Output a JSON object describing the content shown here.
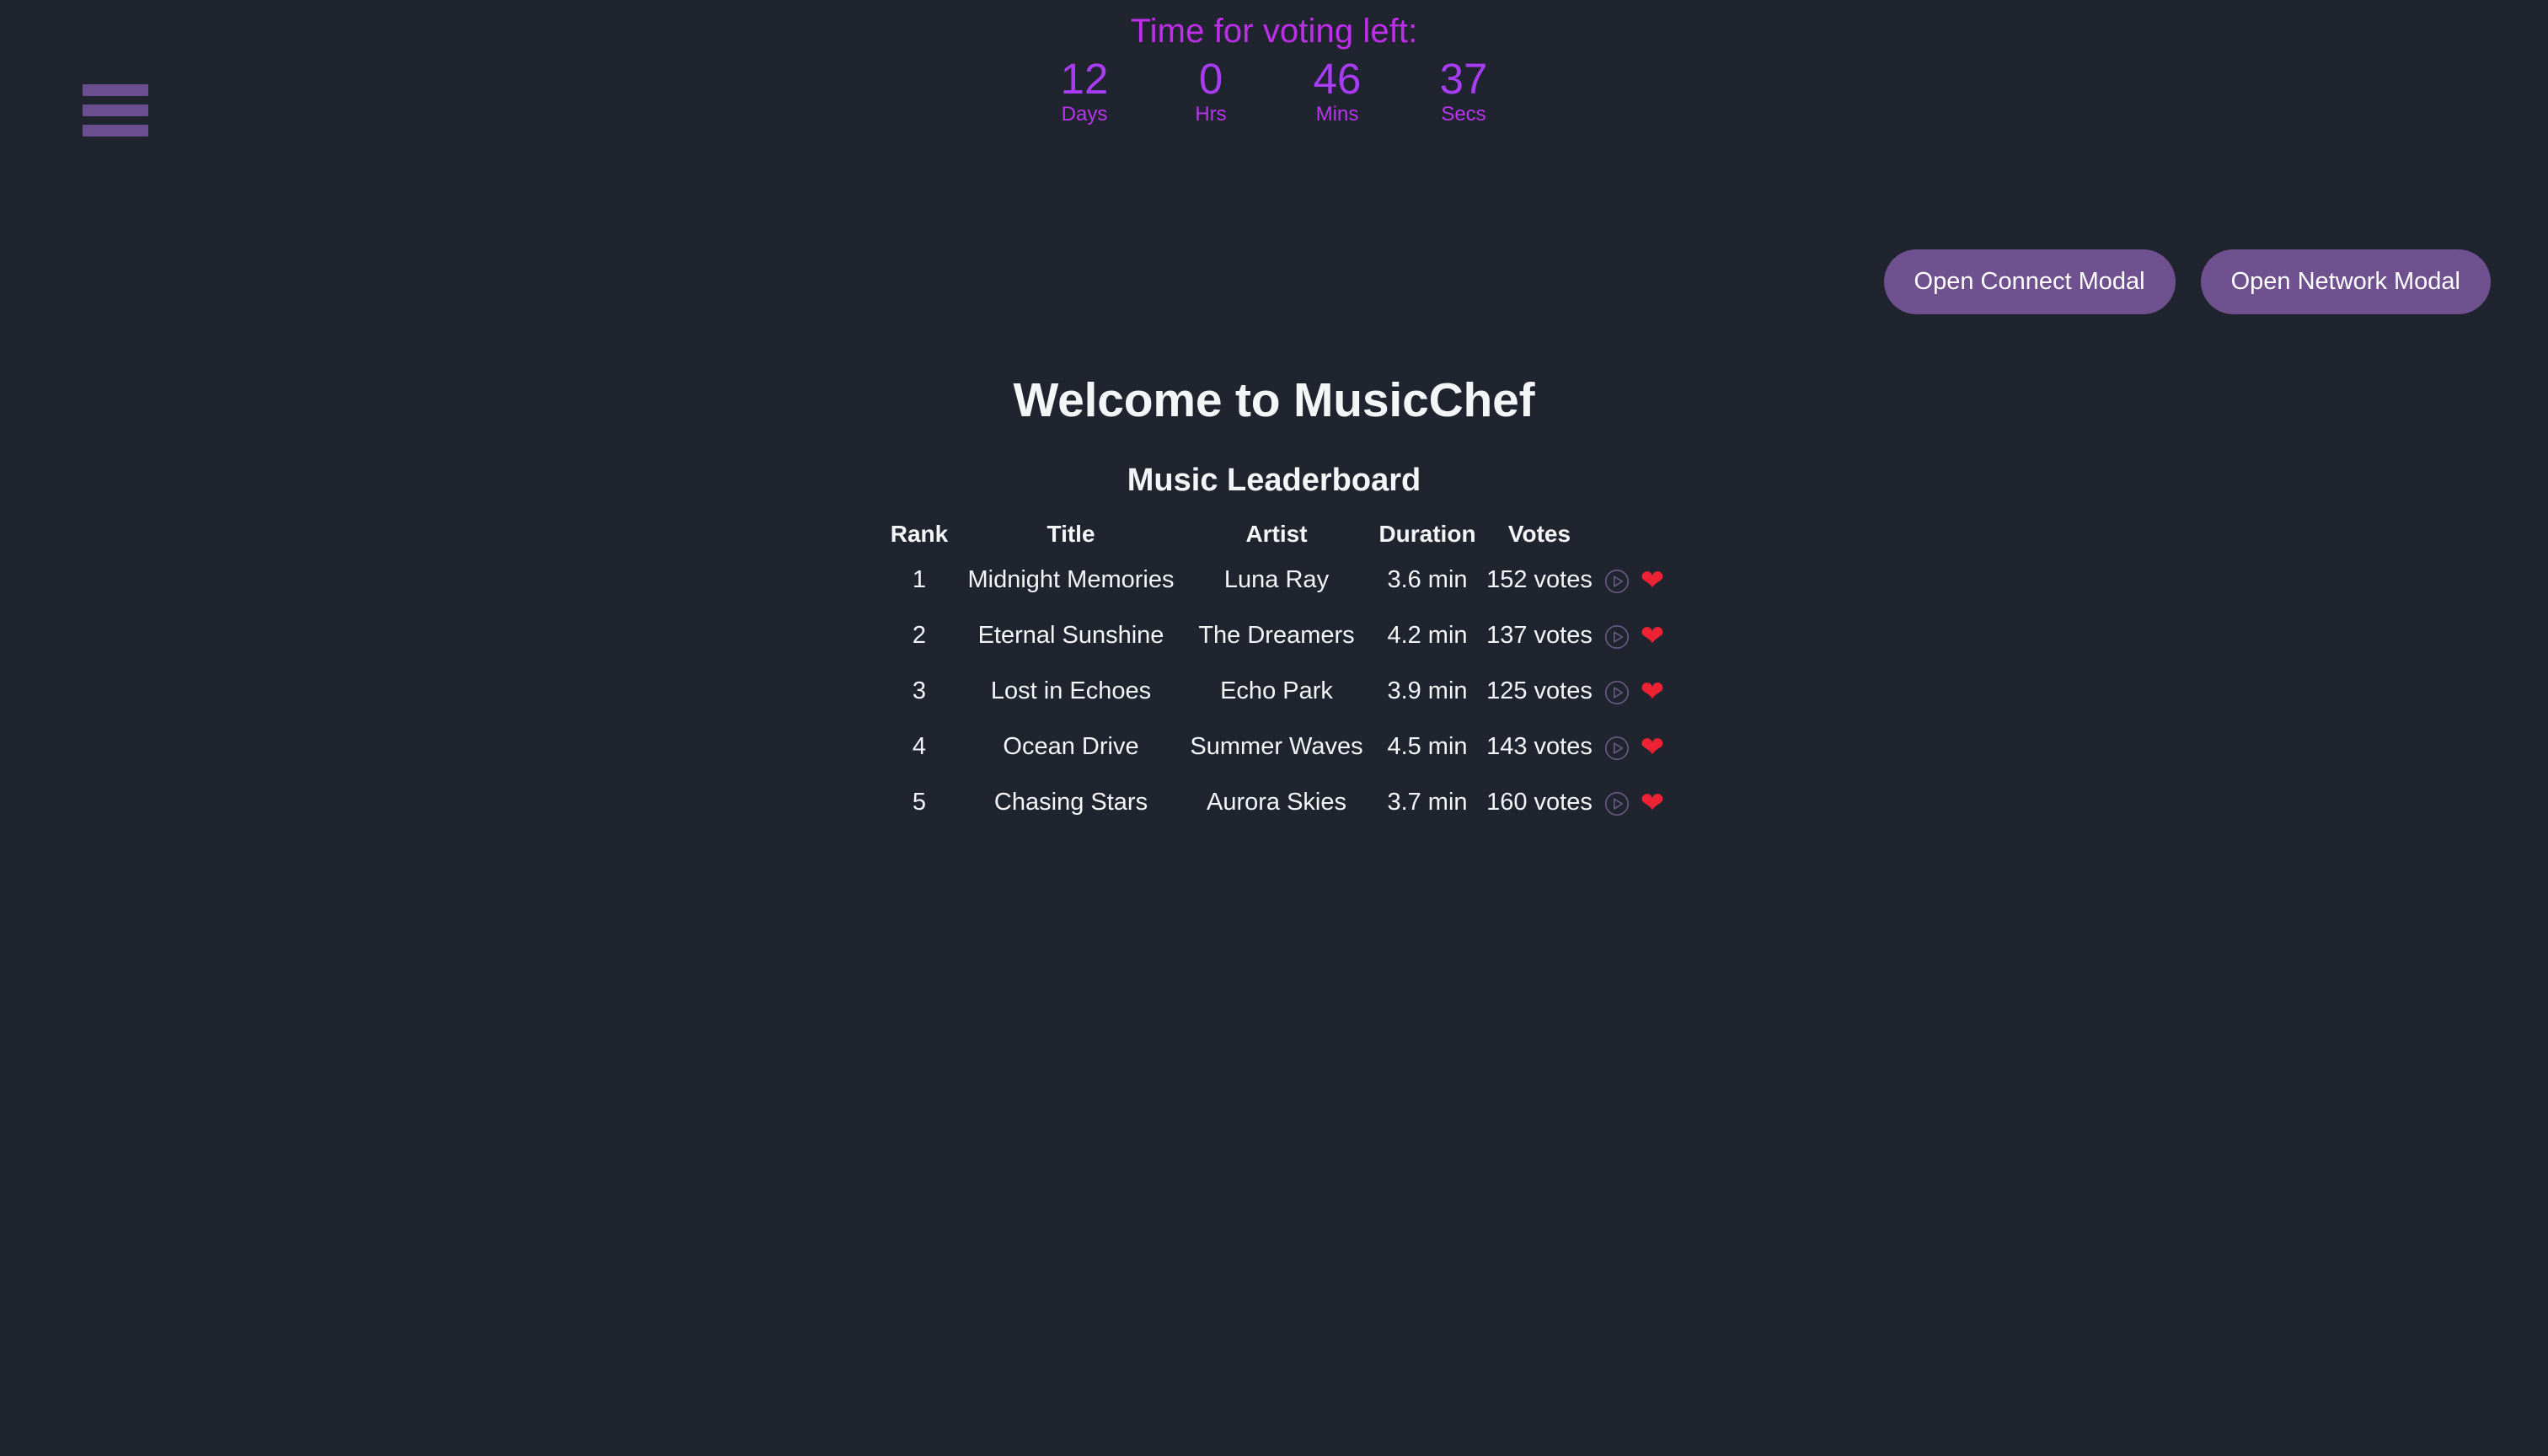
{
  "header": {
    "menu_icon": "hamburger-menu-icon",
    "menu_bar_color": "#6b4e8f"
  },
  "countdown": {
    "title": "Time for voting left:",
    "title_color": "#bf2feb",
    "value_color": "#a93cf5",
    "label_color": "#b935ef",
    "units": [
      {
        "value": "12",
        "label": "Days"
      },
      {
        "value": "0",
        "label": "Hrs"
      },
      {
        "value": "46",
        "label": "Mins"
      },
      {
        "value": "37",
        "label": "Secs"
      }
    ]
  },
  "toolbar": {
    "connect_modal_label": "Open Connect Modal",
    "network_modal_label": "Open Network Modal",
    "button_color": "#6f5190"
  },
  "main": {
    "welcome_title": "Welcome to MusicChef",
    "leaderboard_title": "Music Leaderboard",
    "background_color": "#20242f",
    "text_color": "#f4f5f7"
  },
  "leaderboard": {
    "columns": [
      "Rank",
      "Title",
      "Artist",
      "Duration",
      "Votes"
    ],
    "play_icon": "play-circle-icon",
    "like_icon": "heart-icon",
    "play_icon_color": "#6b5a85",
    "like_icon_color": "#ef2233",
    "rows": [
      {
        "rank": "1",
        "title": "Midnight Memories",
        "artist": "Luna Ray",
        "duration": "3.6 min",
        "votes": "152 votes"
      },
      {
        "rank": "2",
        "title": "Eternal Sunshine",
        "artist": "The Dreamers",
        "duration": "4.2 min",
        "votes": "137 votes"
      },
      {
        "rank": "3",
        "title": "Lost in Echoes",
        "artist": "Echo Park",
        "duration": "3.9 min",
        "votes": "125 votes"
      },
      {
        "rank": "4",
        "title": "Ocean Drive",
        "artist": "Summer Waves",
        "duration": "4.5 min",
        "votes": "143 votes"
      },
      {
        "rank": "5",
        "title": "Chasing Stars",
        "artist": "Aurora Skies",
        "duration": "3.7 min",
        "votes": "160 votes"
      }
    ]
  }
}
